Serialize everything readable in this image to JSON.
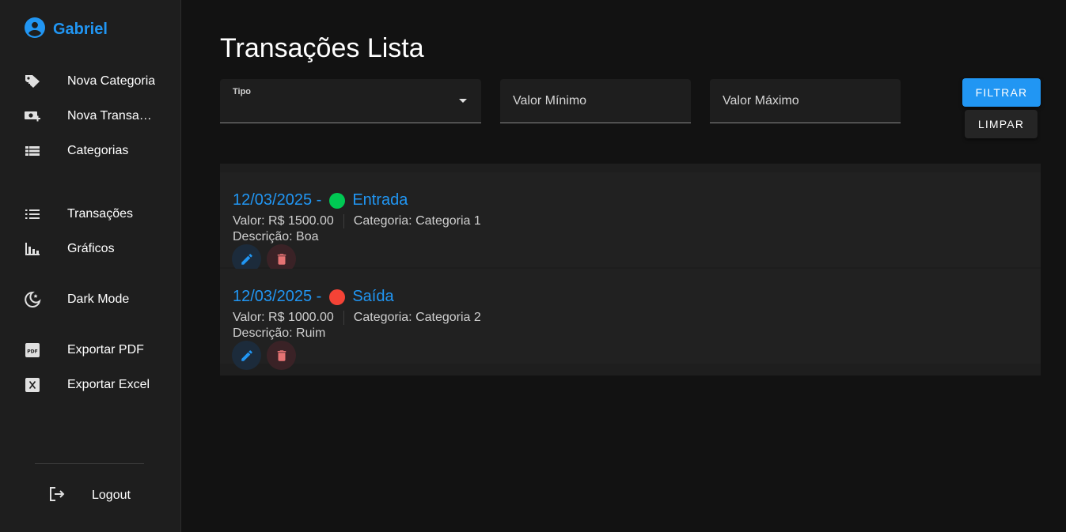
{
  "user": {
    "name": "Gabriel"
  },
  "sidebar": {
    "items": [
      {
        "label": "Nova Categoria",
        "icon": "tag-plus-icon"
      },
      {
        "label": "Nova Transação",
        "icon": "cash-plus-icon"
      },
      {
        "label": "Categorias",
        "icon": "table-icon"
      },
      {
        "label": "Transações",
        "icon": "list-icon"
      },
      {
        "label": "Gráficos",
        "icon": "bar-chart-icon"
      },
      {
        "label": "Dark Mode",
        "icon": "moon-icon"
      },
      {
        "label": "Exportar PDF",
        "icon": "pdf-icon"
      },
      {
        "label": "Exportar Excel",
        "icon": "excel-icon"
      }
    ],
    "logout_label": "Logout"
  },
  "main": {
    "title": "Transações Lista",
    "filters": {
      "tipo_label": "Tipo",
      "tipo_value": "",
      "valor_min_placeholder": "Valor Mínimo",
      "valor_max_placeholder": "Valor Máximo",
      "filter_button": "FILTRAR",
      "clear_button": "LIMPAR"
    },
    "transactions": [
      {
        "date": "12/03/2025 -",
        "type": "Entrada",
        "type_color": "#00c853",
        "valor": "Valor: R$ 1500.00",
        "categoria": "Categoria: Categoria 1",
        "descricao": "Descrição: Boa"
      },
      {
        "date": "12/03/2025 -",
        "type": "Saída",
        "type_color": "#f44336",
        "valor": "Valor: R$ 1000.00",
        "categoria": "Categoria: Categoria 2",
        "descricao": "Descrição: Ruim"
      }
    ]
  },
  "colors": {
    "accent": "#2196f3",
    "delete": "#e57373",
    "background": "#121212",
    "sidebar": "#1e1e1e"
  }
}
